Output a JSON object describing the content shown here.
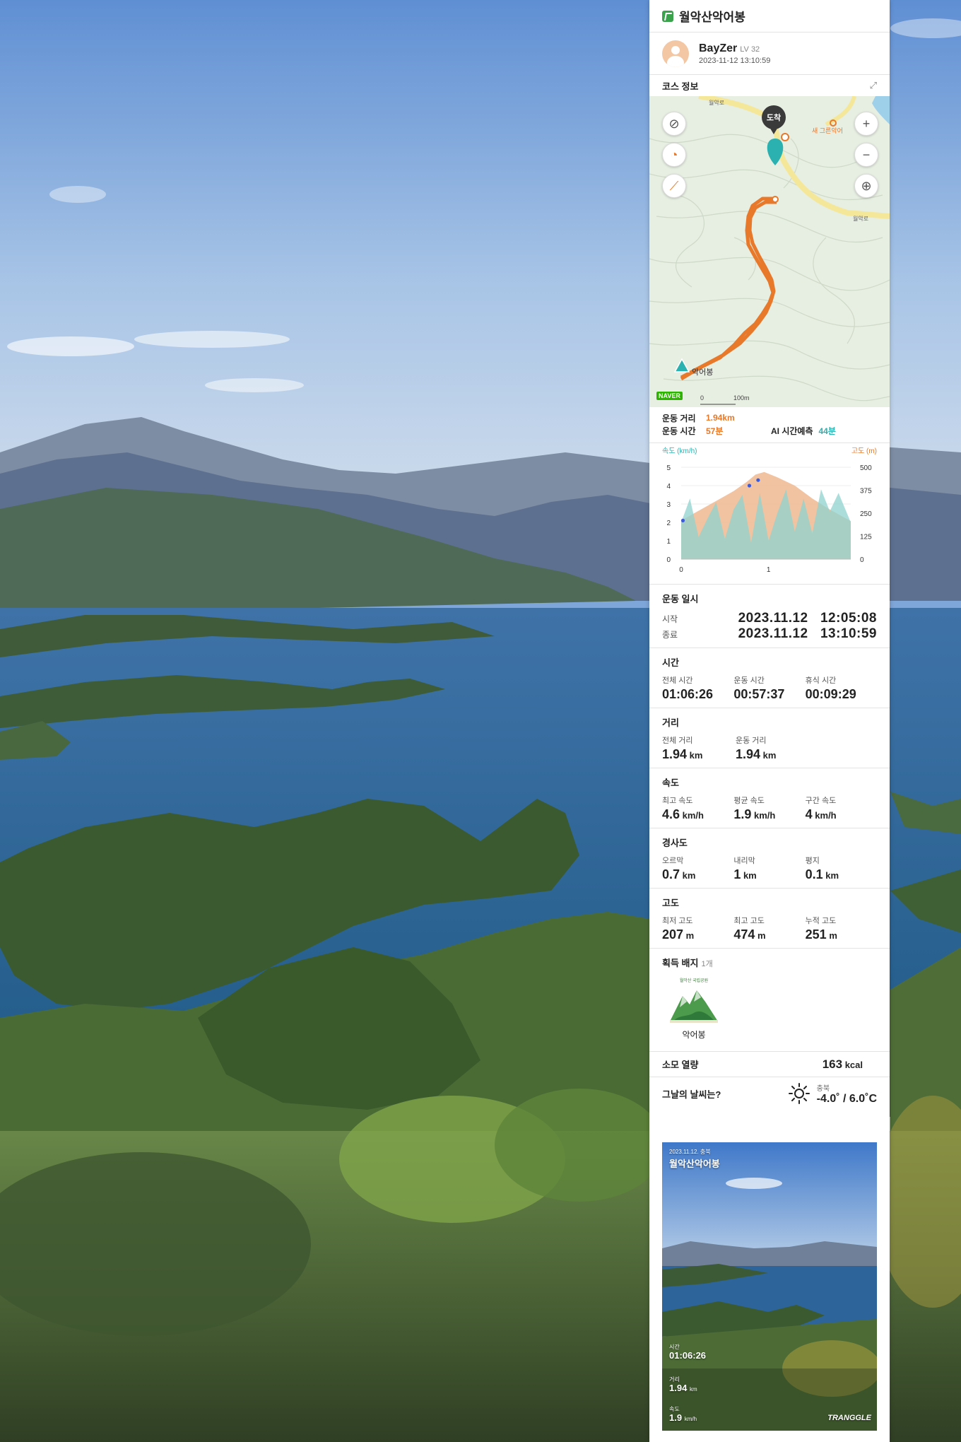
{
  "header": {
    "title": "월악산악어봉"
  },
  "user": {
    "name": "BayZer",
    "level": "LV 32",
    "datetime": "2023-11-12 13:10:59"
  },
  "course": {
    "section_title": "코스 정보",
    "map": {
      "road_labels": [
        "월악로",
        "월악로"
      ],
      "arrival_label": "도착",
      "place_label": "새 그른악어",
      "peak_label": "악어봉",
      "naver_label": "NAVER",
      "scale_zero": "0",
      "scale_label": "100m",
      "zoom_in": "+",
      "zoom_out": "−"
    },
    "distance_label": "운동 거리",
    "distance_value": "1.94km",
    "time_label": "운동 시간",
    "time_value": "57분",
    "ai_label": "AI 시간예측",
    "ai_value": "44분"
  },
  "chart_data": {
    "type": "area",
    "y_left_label": "속도 (km/h)",
    "y_right_label": "고도 (m)",
    "y_left_ticks": [
      "5",
      "4",
      "3",
      "2",
      "1",
      "0"
    ],
    "y_right_ticks": [
      "500",
      "375",
      "250",
      "125",
      "0"
    ],
    "x_ticks": [
      "0",
      "1"
    ],
    "ylim_left": [
      0,
      5
    ],
    "ylim_right": [
      0,
      500
    ],
    "xlim": [
      0,
      1.94
    ],
    "series": [
      {
        "name": "고도 (m)",
        "color": "#f0b891",
        "x": [
          0,
          0.15,
          0.3,
          0.45,
          0.6,
          0.75,
          0.85,
          0.95,
          1.1,
          1.3,
          1.5,
          1.7,
          1.94
        ],
        "values": [
          210,
          250,
          290,
          330,
          370,
          420,
          460,
          474,
          445,
          400,
          330,
          270,
          207
        ]
      },
      {
        "name": "속도 (km/h)",
        "color": "#8fd3cf",
        "x": [
          0,
          0.1,
          0.2,
          0.3,
          0.4,
          0.5,
          0.6,
          0.7,
          0.8,
          0.9,
          1.0,
          1.1,
          1.2,
          1.3,
          1.4,
          1.5,
          1.6,
          1.7,
          1.8,
          1.94
        ],
        "values": [
          2.0,
          3.3,
          1.2,
          2.2,
          3.1,
          1.1,
          2.7,
          3.5,
          0.9,
          3.6,
          1.0,
          2.5,
          3.8,
          1.5,
          3.3,
          1.4,
          3.8,
          2.6,
          3.6,
          2.0
        ]
      }
    ],
    "points": [
      {
        "x": 0.02,
        "y": 2.1
      },
      {
        "x": 0.78,
        "y": 4.0
      },
      {
        "x": 0.88,
        "y": 4.3
      }
    ]
  },
  "datetime_block": {
    "title": "운동 일시",
    "start_label": "시작",
    "start_value": "2023.11.12   12:05:08",
    "end_label": "종료",
    "end_value": "2023.11.12   13:10:59"
  },
  "time_block": {
    "title": "시간",
    "items": [
      {
        "label": "전체 시간",
        "value": "01:06:26"
      },
      {
        "label": "운동 시간",
        "value": "00:57:37"
      },
      {
        "label": "휴식 시간",
        "value": "00:09:29"
      }
    ]
  },
  "distance_block": {
    "title": "거리",
    "items": [
      {
        "label": "전체 거리",
        "value": "1.94",
        "unit": " km"
      },
      {
        "label": "운동 거리",
        "value": "1.94",
        "unit": " km"
      }
    ]
  },
  "speed_block": {
    "title": "속도",
    "items": [
      {
        "label": "최고 속도",
        "value": "4.6",
        "unit": " km/h"
      },
      {
        "label": "평균 속도",
        "value": "1.9",
        "unit": " km/h"
      },
      {
        "label": "구간 속도",
        "value": "4",
        "unit": " km/h"
      }
    ]
  },
  "slope_block": {
    "title": "경사도",
    "items": [
      {
        "label": "오르막",
        "value": "0.7",
        "unit": " km"
      },
      {
        "label": "내리막",
        "value": "1",
        "unit": " km"
      },
      {
        "label": "평지",
        "value": "0.1",
        "unit": " km"
      }
    ]
  },
  "alt_block": {
    "title": "고도",
    "items": [
      {
        "label": "최저 고도",
        "value": "207",
        "unit": " m"
      },
      {
        "label": "최고 고도",
        "value": "474",
        "unit": " m"
      },
      {
        "label": "누적 고도",
        "value": "251",
        "unit": " m"
      }
    ]
  },
  "badge_block": {
    "title": "획득 배지",
    "count": "1개",
    "badge_name": "악어봉",
    "badge_top_text": "월악산 국립공원"
  },
  "calories": {
    "label": "소모 열량",
    "value": "163",
    "unit": " kcal"
  },
  "weather": {
    "label": "그날의 날씨는?",
    "location": "충북",
    "temp": "-4.0˚ / 6.0˚C",
    "icon": "sun-icon"
  },
  "share_card": {
    "date_loc": "2023.11.12. 충북",
    "title": "월악산악어봉",
    "time_label": "시간",
    "time_value": "01:06:26",
    "dist_label": "거리",
    "dist_value": "1.94",
    "dist_unit": "km",
    "speed_label": "속도",
    "speed_value": "1.9",
    "speed_unit": "km/h",
    "brand": "TRANGGLE"
  },
  "colors": {
    "accent": "#e8782a",
    "teal": "#2bb2b0",
    "route": "#e8782a"
  }
}
